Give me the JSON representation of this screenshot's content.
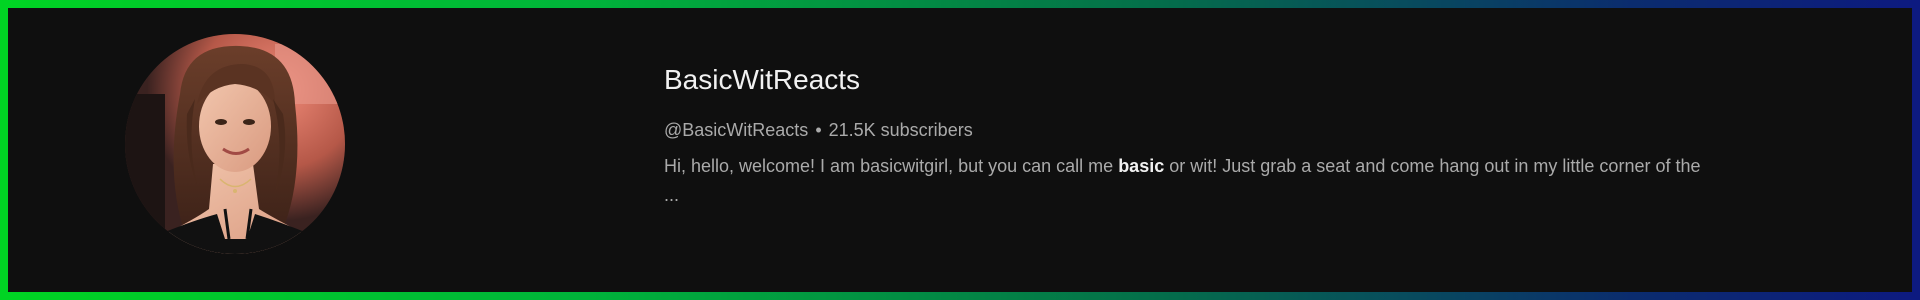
{
  "channel": {
    "name": "BasicWitReacts",
    "handle": "@BasicWitReacts",
    "separator": "•",
    "subscribers": "21.5K subscribers",
    "description": {
      "part1": "Hi, hello, welcome! I am basicwitgirl, but you can call me ",
      "highlight": "basic",
      "part2": " or wit! Just grab a seat and come hang out in my little corner of the ..."
    }
  },
  "colors": {
    "background": "#0f0f0f",
    "border_gradient_start": "#00d423",
    "border_gradient_end": "#0d1a80",
    "primary_text": "#f1f1f1",
    "secondary_text": "#aaaaaa"
  },
  "icons": {
    "avatar": "channel-avatar-photo"
  }
}
